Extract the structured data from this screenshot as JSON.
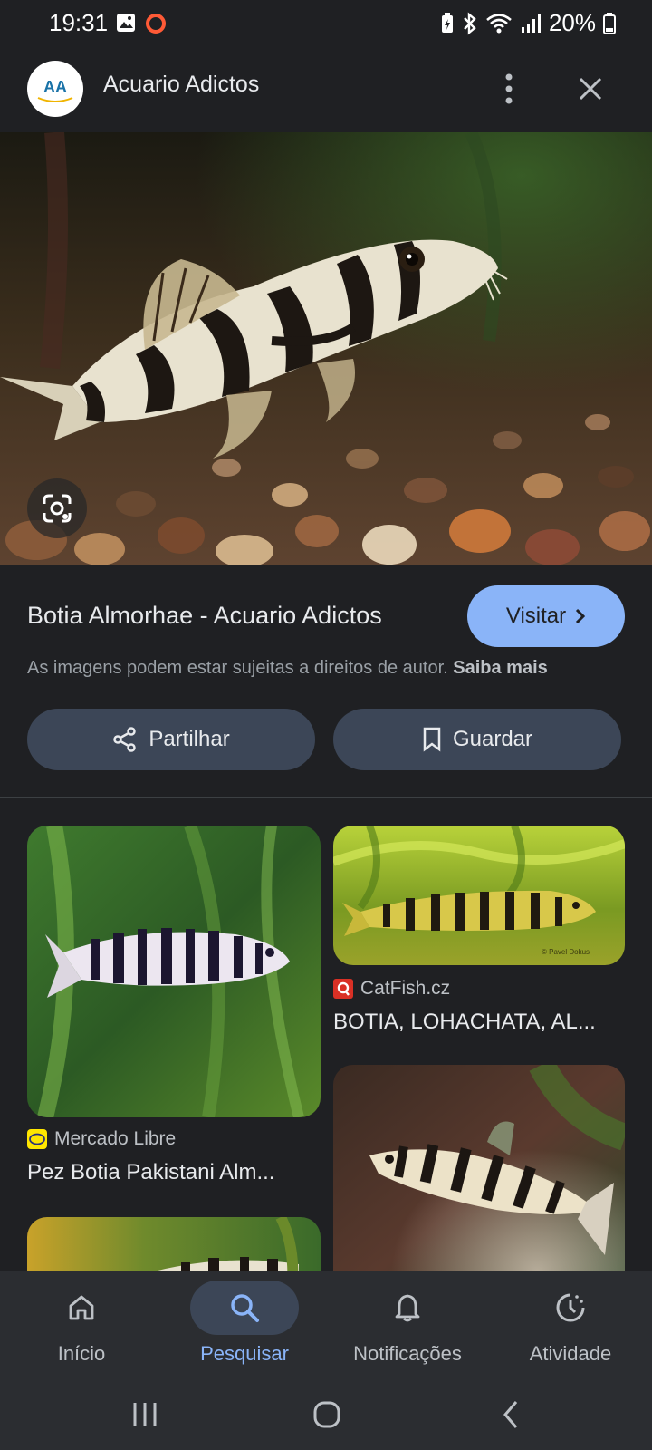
{
  "status_bar": {
    "time": "19:31",
    "battery": "20%"
  },
  "header": {
    "site_name": "Acuario Adictos",
    "logo_text": "AA",
    "more_icon": "more-vert-icon",
    "close_icon": "close-icon"
  },
  "result": {
    "title": "Botia Almorhae - Acuario Adictos",
    "visit_label": "Visitar",
    "copyright_text": "As imagens podem estar sujeitas a direitos de autor.",
    "learn_more": "Saiba mais",
    "share_label": "Partilhar",
    "save_label": "Guardar"
  },
  "related": [
    {
      "source": "Mercado Libre",
      "title": "Pez Botia Pakistani Alm..."
    },
    {
      "source": "CatFish.cz",
      "title": "BOTIA, LOHACHATA, AL...",
      "watermark": "© Pavel Dokus"
    },
    {
      "source": "",
      "title": ""
    },
    {
      "source": "",
      "title": ""
    }
  ],
  "bottom_nav": [
    {
      "label": "Início",
      "icon": "home-icon"
    },
    {
      "label": "Pesquisar",
      "icon": "search-icon",
      "active": true
    },
    {
      "label": "Notificações",
      "icon": "bell-icon"
    },
    {
      "label": "Atividade",
      "icon": "activity-icon"
    }
  ],
  "colors": {
    "background": "#1f2023",
    "accent": "#8ab4f8",
    "button": "#3c4657",
    "catfish_red": "#d93025"
  }
}
